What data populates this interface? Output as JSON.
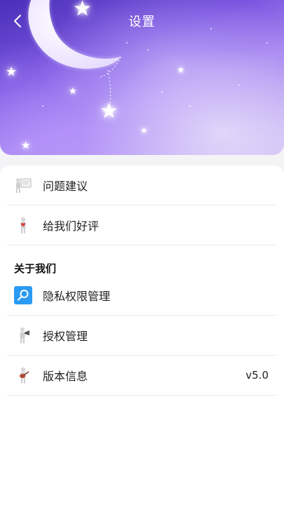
{
  "header": {
    "title": "设置",
    "back_icon": "chevron-left-icon"
  },
  "feedback_group": [
    {
      "label": "问题建议",
      "icon": "figure-with-board-icon"
    },
    {
      "label": "给我们好评",
      "icon": "figure-with-heart-icon"
    }
  ],
  "about_section": {
    "title": "关于我们",
    "items": [
      {
        "label": "隐私权限管理",
        "icon": "magnifier-icon"
      },
      {
        "label": "授权管理",
        "icon": "figure-with-megaphone-icon"
      },
      {
        "label": "版本信息",
        "icon": "figure-with-guitar-icon",
        "value": "v5.0"
      }
    ]
  },
  "colors": {
    "banner_start": "#4a2fb8",
    "banner_end": "#c9b7f4",
    "accent_blue": "#2b9af3"
  }
}
